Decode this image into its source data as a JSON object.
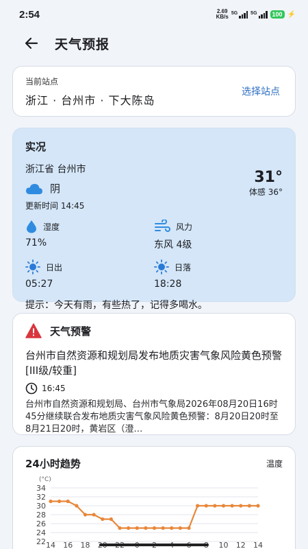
{
  "status_bar": {
    "time": "2:54",
    "speed_value": "2.69",
    "speed_unit": "KB/s",
    "sig1_tag": "5G",
    "sig2_tag": "5G",
    "battery": "100",
    "charging_glyph": "⚡"
  },
  "header": {
    "title": "天气预报",
    "back_icon": "arrow-left-icon"
  },
  "station": {
    "label": "当前站点",
    "value": "浙江 · 台州市 · 下大陈岛",
    "select_label": "选择站点"
  },
  "live": {
    "title": "实况",
    "location": "浙江省 台州市",
    "weather": "阴",
    "weather_icon": "cloud-icon",
    "update_time": "更新时间 14:45",
    "temperature": "31°",
    "feels_like": "体感 36°",
    "humidity_label": "湿度",
    "humidity_value": "71%",
    "wind_label": "风力",
    "wind_value": "东风 4级",
    "sunrise_label": "日出",
    "sunrise_value": "05:27",
    "sunset_label": "日落",
    "sunset_value": "18:28",
    "tip": "提示：今天有雨，有些热了，记得多喝水。"
  },
  "warning": {
    "title": "天气预警",
    "headline": "台州市自然资源和规划局发布地质灾害气象风险黄色预警[III级/较重]",
    "time": "16:45",
    "body": "台州市自然资源和规划局、台州市气象局2026年08月20日16时45分继续联合发布地质灾害气象风险黄色预警：8月20日20时至8月21日20时，黄岩区（澄…"
  },
  "trend": {
    "title": "24小时趋势",
    "mode": "温度"
  },
  "chart_data": {
    "type": "line",
    "ylabel": "(°C)",
    "yticks": [
      22,
      24,
      26,
      28,
      30,
      32,
      34
    ],
    "ylim": [
      22,
      34
    ],
    "x_tick_labels": [
      "14",
      "16",
      "18",
      "20",
      "22",
      "0",
      "2",
      "4",
      "6",
      "8",
      "10",
      "12",
      "14"
    ],
    "x": [
      "14",
      "15",
      "16",
      "17",
      "18",
      "19",
      "20",
      "21",
      "22",
      "23",
      "0",
      "1",
      "2",
      "3",
      "4",
      "5",
      "6",
      "7",
      "8",
      "9",
      "10",
      "11",
      "12",
      "13",
      "14"
    ],
    "series": [
      {
        "values": [
          31,
          31,
          31,
          30,
          28,
          28,
          27,
          27,
          25,
          25,
          25,
          25,
          25,
          25,
          25,
          25,
          25,
          30,
          30,
          30,
          30,
          30,
          30,
          30,
          30
        ]
      }
    ],
    "grid": true,
    "color": "#e8873a"
  },
  "colors": {
    "accent": "#2e6fc2",
    "live_card_bg": "#d4e6f8",
    "warning_red": "#d9363e",
    "icon_blue": "#2f8be0",
    "sun_blue": "#2a7bd6",
    "battery_green": "#32c65b"
  }
}
